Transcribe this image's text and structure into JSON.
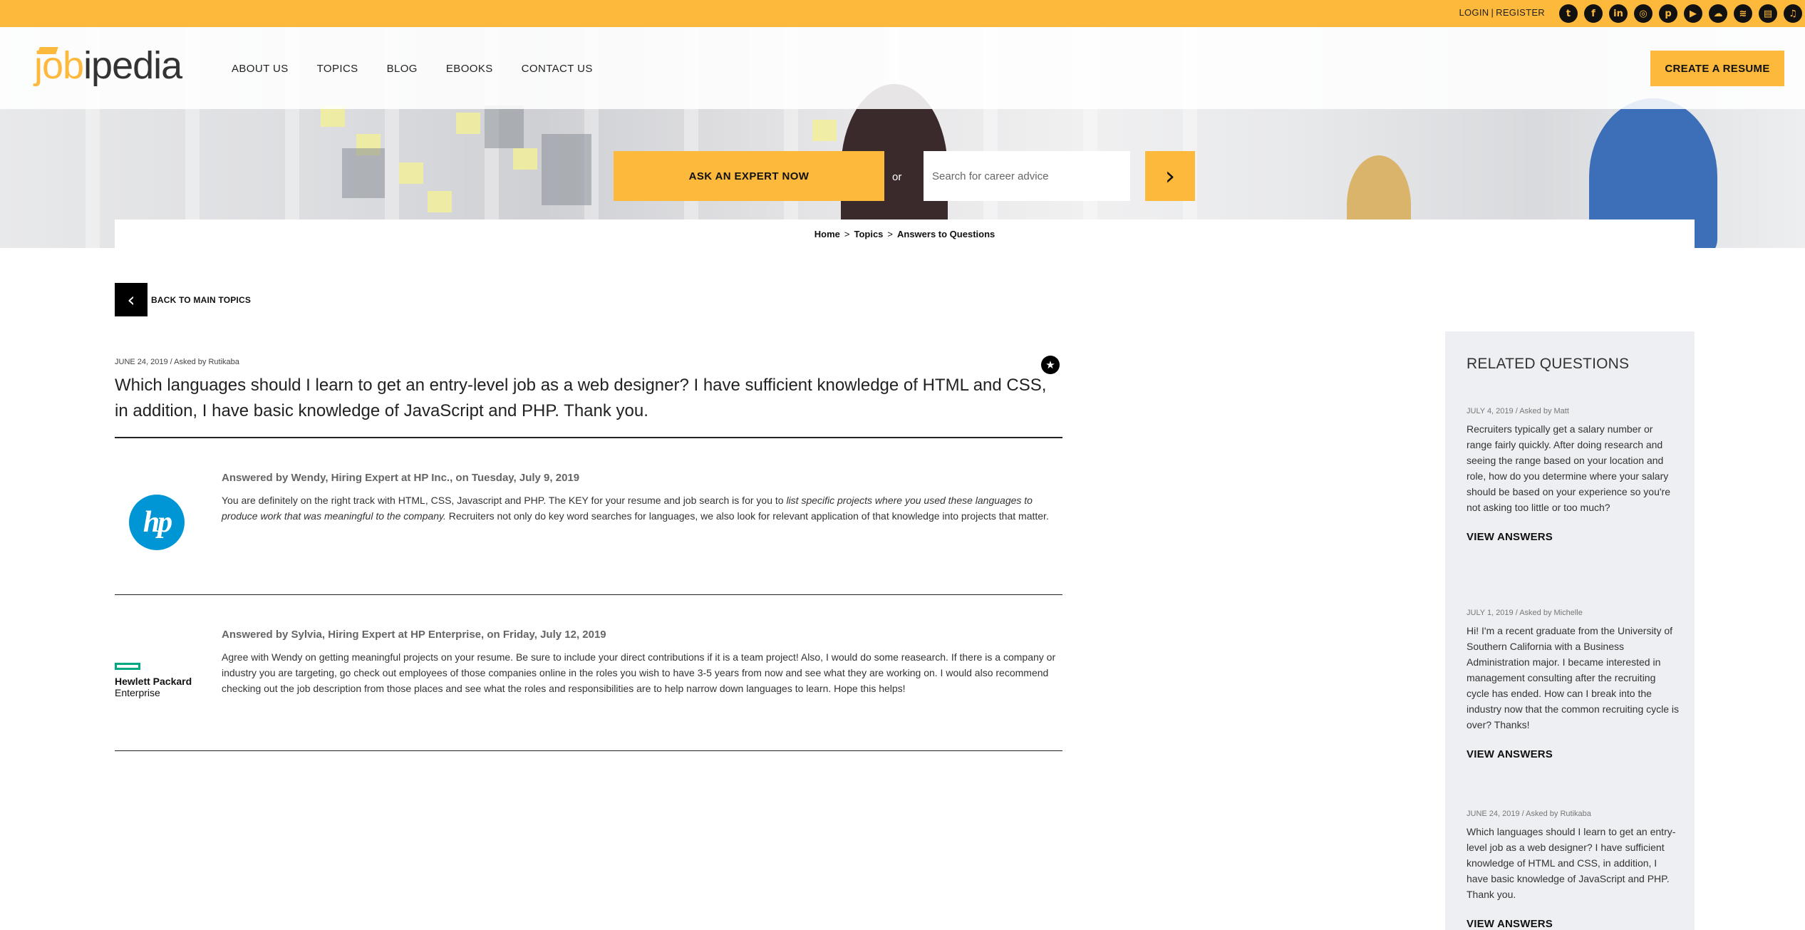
{
  "topbar": {
    "login": "LOGIN",
    "register": "REGISTER",
    "social_icons": [
      "twitter-icon",
      "facebook-icon",
      "linkedin-icon",
      "instagram-icon",
      "pinterest-icon",
      "youtube-icon",
      "soundcloud-icon",
      "spotify-icon",
      "stitcher-icon",
      "itunes-icon"
    ]
  },
  "brand": {
    "logo_job": "job",
    "logo_ipedia": "ipedia",
    "accent": "#fdb93c"
  },
  "nav": {
    "items": [
      "ABOUT US",
      "TOPICS",
      "BLOG",
      "EBOOKS",
      "CONTACT US"
    ],
    "create_resume": "CREATE A RESUME"
  },
  "hero": {
    "ask_expert": "ASK AN EXPERT NOW",
    "or": "or",
    "search_placeholder": "Search for career advice"
  },
  "breadcrumb": [
    "Home",
    "Topics",
    "Answers to Questions"
  ],
  "back": {
    "label": "BACK TO MAIN TOPICS"
  },
  "question": {
    "meta": "JUNE 24, 2019 / Asked by Rutikaba",
    "text": "Which languages should I learn to get an entry-level job as a web designer? I have sufficient knowledge of HTML and CSS, in addition, I have basic knowledge of JavaScript and PHP. Thank you."
  },
  "answers": [
    {
      "company": "hp",
      "by": "Answered by Wendy, Hiring Expert at HP Inc., on Tuesday, July 9, 2019",
      "text_before": "You are definitely on the right track with HTML, CSS, Javascript and PHP.  The KEY for your resume and job search is for you to ",
      "text_italic": "list specific projects where you used these languages to produce work that was meaningful to the company.",
      "text_after": "  Recruiters not only do key word searches for languages, we also look for relevant application of that knowledge into projects that matter."
    },
    {
      "company_line1": "Hewlett Packard",
      "company_line2": "Enterprise",
      "by": "Answered by Sylvia, Hiring Expert at HP Enterprise, on Friday, July 12, 2019",
      "text": "Agree with Wendy on getting meaningful projects on your resume. Be sure to include your direct contributions if it is a team project! Also, I would do some reasearch. If there is a company or industry you are targeting, go check out employees of those companies online in the roles you wish to have 3-5 years from now and see what they are working on. I would also recommend checking out the job description from those places and see what the roles and responsibilities are to help narrow down languages to learn. Hope this helps!"
    }
  ],
  "sidebar": {
    "title": "RELATED QUESTIONS",
    "items": [
      {
        "meta": "JULY 4, 2019 / Asked by Matt",
        "text": "Recruiters typically get a salary number or range fairly quickly. After doing research and seeing the range based on your location and role, how do you determine where your salary should be based on your experience so you're not asking too little or too much?",
        "view": "VIEW ANSWERS"
      },
      {
        "meta": "JULY 1, 2019 / Asked by Michelle",
        "text": "Hi! I'm a recent graduate from the University of Southern California with a Business Administration major. I became interested in management consulting after the recruiting cycle has ended. How can I break into the industry now that the common recruiting cycle is over? Thanks!",
        "view": "VIEW ANSWERS"
      },
      {
        "meta": "JUNE 24, 2019 / Asked by Rutikaba",
        "text": "Which languages should I learn to get an entry-level job as a web designer? I have sufficient knowledge of HTML and CSS, in addition, I have basic knowledge of JavaScript and PHP. Thank you.",
        "view": "VIEW ANSWERS"
      }
    ]
  }
}
